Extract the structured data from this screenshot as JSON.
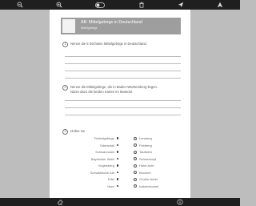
{
  "toolbar": {
    "icons": [
      "zoom-out-icon",
      "zoom-in-icon",
      "toggle-icon",
      "delete-icon",
      "send-icon",
      "paper-plane-icon"
    ]
  },
  "worksheet": {
    "title": "AB: Mittelgebirge in Deutschland",
    "subtitle": "Mittelgebirge",
    "q1": {
      "number": "1",
      "text": "Nenne die 5 höchsten Mittelgebirge in Deutschland."
    },
    "q2": {
      "number": "2",
      "text_line1": "Nenne die Mittelgebirge, die in Baden-Württemberg liegen.",
      "text_line2": "Nutze dazu die beiden Karten im Material."
    },
    "q3": {
      "number": "3",
      "text": "Ordne zu!",
      "left": [
        "Fichtelgebirge",
        "Odenwald",
        "Schwarzwald",
        "Bayrischer Wald",
        "Vogelsberg",
        "Schwäbische Alb",
        "Eifel",
        "Harz"
      ],
      "right": [
        "Lemberg",
        "Feldberg",
        "Taufstein",
        "Schneekopf",
        "Hohe Acht",
        "Brocken",
        "Großer Arber",
        "Katzenbuckel"
      ]
    }
  },
  "bottombar": {
    "icons": [
      "eraser-icon",
      "info-icon"
    ]
  }
}
